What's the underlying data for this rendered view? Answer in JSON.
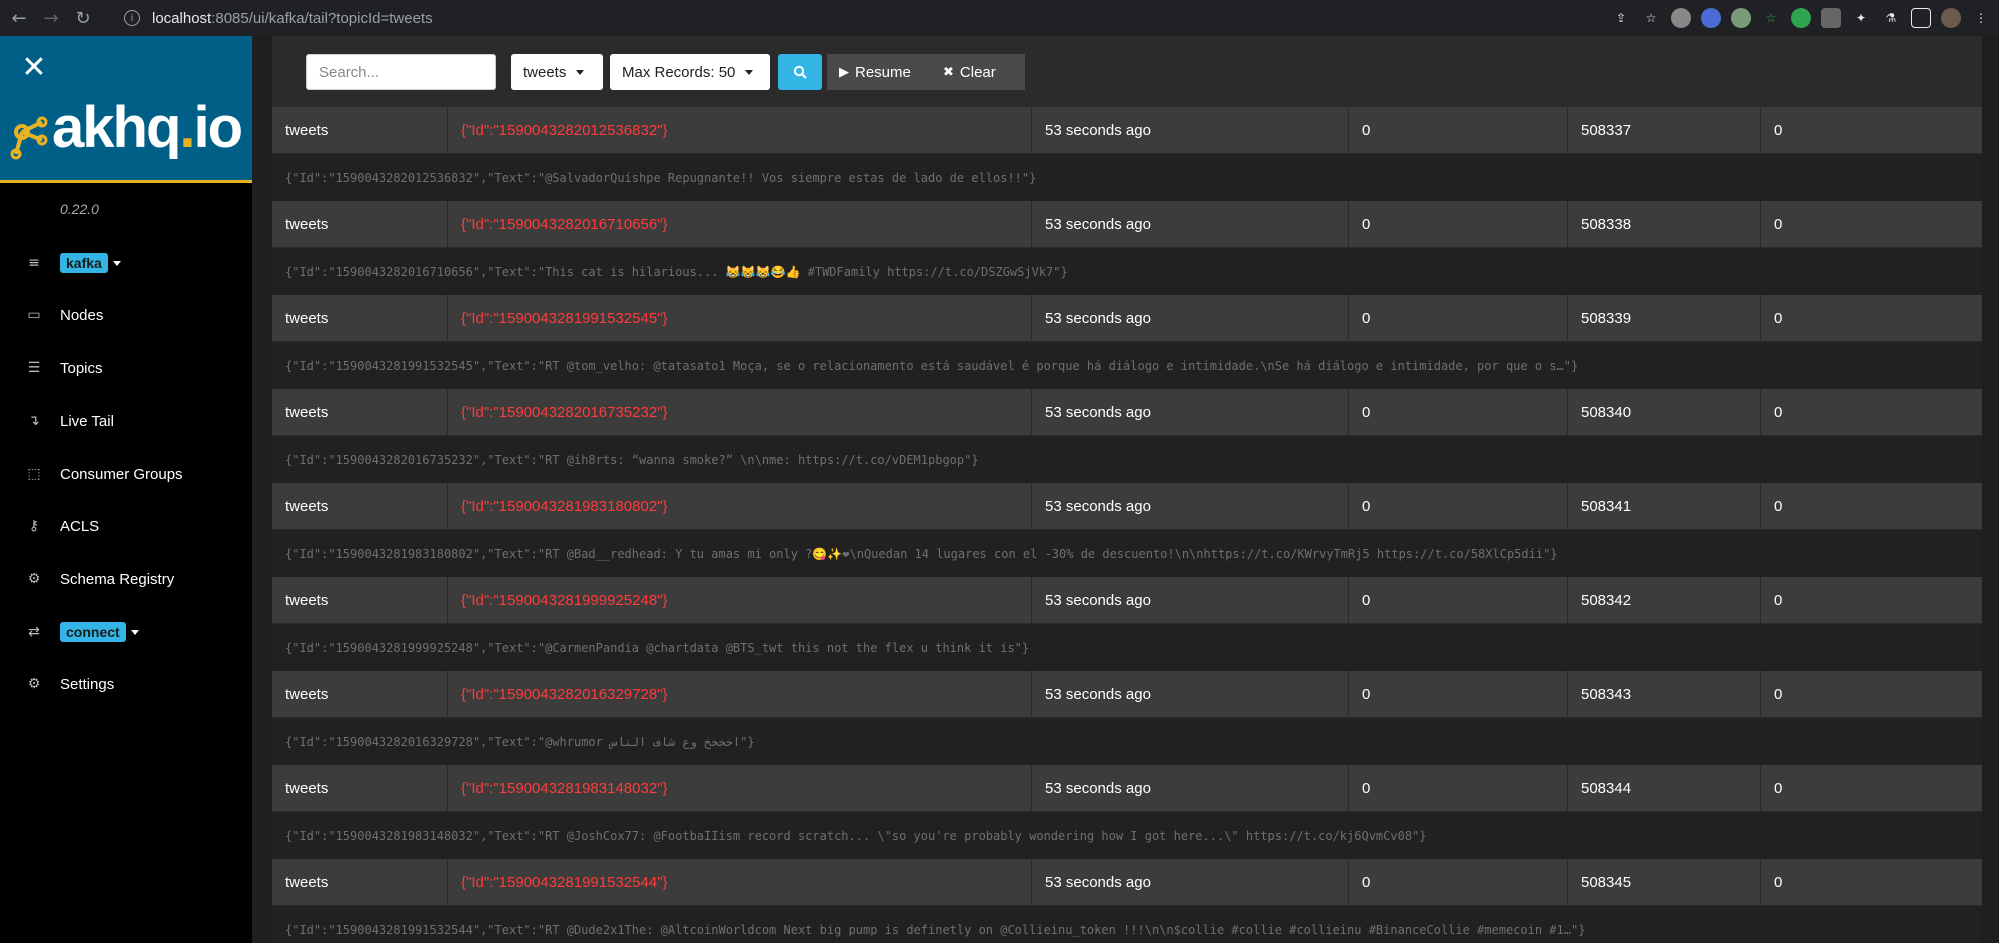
{
  "browser": {
    "url_host": "localhost",
    "url_rest": ":8085/ui/kafka/tail?topicId=tweets"
  },
  "sidebar": {
    "version": "0.22.0",
    "cluster_badge": "kafka",
    "connect_badge": "connect",
    "items": [
      {
        "label": "Nodes",
        "icon": "laptop-icon"
      },
      {
        "label": "Topics",
        "icon": "list-icon"
      },
      {
        "label": "Live Tail",
        "icon": "level-down-icon"
      },
      {
        "label": "Consumer Groups",
        "icon": "object-group-icon"
      },
      {
        "label": "ACLS",
        "icon": "key-icon"
      },
      {
        "label": "Schema Registry",
        "icon": "cogs-icon"
      },
      {
        "label": "Settings",
        "icon": "cog-icon"
      }
    ]
  },
  "toolbar": {
    "search_placeholder": "Search...",
    "topic_select": "tweets",
    "max_records": "Max Records: 50",
    "resume_label": "Resume",
    "clear_label": "Clear"
  },
  "records": [
    {
      "topic": "tweets",
      "key": "{\"Id\":\"1590043282012536832\"}",
      "date": "53 seconds ago",
      "partition": "0",
      "offset": "508337",
      "extra": "0",
      "value": "{\"Id\":\"1590043282012536832\",\"Text\":\"@SalvadorQuishpe Repugnante!! Vos siempre estas de lado de ellos!!\"}"
    },
    {
      "topic": "tweets",
      "key": "{\"Id\":\"1590043282016710656\"}",
      "date": "53 seconds ago",
      "partition": "0",
      "offset": "508338",
      "extra": "0",
      "value": "{\"Id\":\"1590043282016710656\",\"Text\":\"This cat is hilarious... 😹😹😹😂👍 #TWDFamily https://t.co/DSZGwSjVk7\"}"
    },
    {
      "topic": "tweets",
      "key": "{\"Id\":\"1590043281991532545\"}",
      "date": "53 seconds ago",
      "partition": "0",
      "offset": "508339",
      "extra": "0",
      "value": "{\"Id\":\"1590043281991532545\",\"Text\":\"RT @tom_velho: @tatasato1 Moça, se o relacionamento está saudável é porque há diálogo e intimidade.\\nSe há diálogo e intimidade, por que o s…\"}"
    },
    {
      "topic": "tweets",
      "key": "{\"Id\":\"1590043282016735232\"}",
      "date": "53 seconds ago",
      "partition": "0",
      "offset": "508340",
      "extra": "0",
      "value": "{\"Id\":\"1590043282016735232\",\"Text\":\"RT @ih8rts: “wanna smoke?” \\n\\nme: https://t.co/vDEM1pbgop\"}"
    },
    {
      "topic": "tweets",
      "key": "{\"Id\":\"1590043281983180802\"}",
      "date": "53 seconds ago",
      "partition": "0",
      "offset": "508341",
      "extra": "0",
      "value": "{\"Id\":\"1590043281983180802\",\"Text\":\"RT @Bad__redhead: Y tu amas mi only ?😋✨❤\\nQuedan 14 lugares con el -30% de descuento!\\n\\nhttps://t.co/KWrvyTmRj5 https://t.co/58XlCp5dii\"}"
    },
    {
      "topic": "tweets",
      "key": "{\"Id\":\"1590043281999925248\"}",
      "date": "53 seconds ago",
      "partition": "0",
      "offset": "508342",
      "extra": "0",
      "value": "{\"Id\":\"1590043281999925248\",\"Text\":\"@CarmenPandia @chartdata @BTS_twt this not the flex u think it is\"}"
    },
    {
      "topic": "tweets",
      "key": "{\"Id\":\"1590043282016329728\"}",
      "date": "53 seconds ago",
      "partition": "0",
      "offset": "508343",
      "extra": "0",
      "value": "{\"Id\":\"1590043282016329728\",\"Text\":\"@whrumor اخخخخ وع شاف الناس\"}"
    },
    {
      "topic": "tweets",
      "key": "{\"Id\":\"1590043281983148032\"}",
      "date": "53 seconds ago",
      "partition": "0",
      "offset": "508344",
      "extra": "0",
      "value": "{\"Id\":\"1590043281983148032\",\"Text\":\"RT @JoshCox77: @FootbaIIism record scratch... \\\"so you're probably wondering how I got here...\\\" https://t.co/kj6QvmCv08\"}"
    },
    {
      "topic": "tweets",
      "key": "{\"Id\":\"1590043281991532544\"}",
      "date": "53 seconds ago",
      "partition": "0",
      "offset": "508345",
      "extra": "0",
      "value": "{\"Id\":\"1590043281991532544\",\"Text\":\"RT @Dude2x1The: @AltcoinWorldcom Next big pump is definetly on @Collieinu_token !!!\\n\\n$collie #collie #collieinu #BinanceCollie #memecoin #1…\"}"
    }
  ],
  "colors": {
    "accent": "#33b5e5",
    "logo_bg": "#005f87",
    "logo_underline": "#e8b320",
    "key_red": "#ff3b3b"
  }
}
